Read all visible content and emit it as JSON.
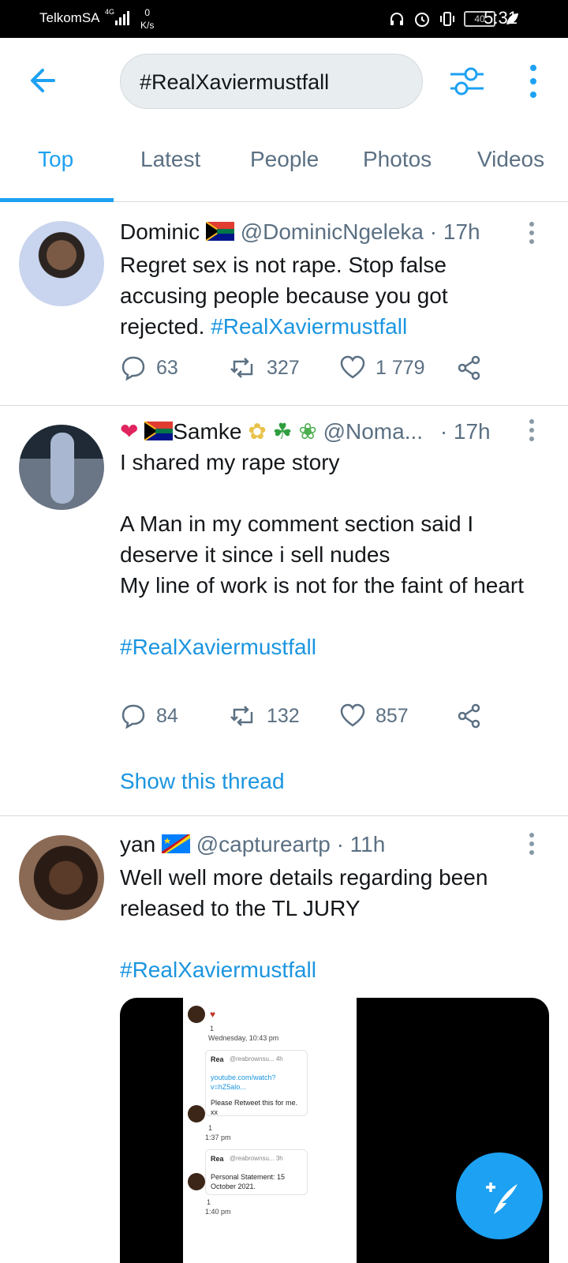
{
  "status_bar": {
    "carrier": "TelkomSA",
    "network": "4G",
    "speed_value": "0",
    "speed_unit": "K/s",
    "battery": "40",
    "time": "5:31"
  },
  "search": {
    "query": "#RealXaviermustfall"
  },
  "tabs": [
    {
      "label": "Top",
      "active": true
    },
    {
      "label": "Latest",
      "active": false
    },
    {
      "label": "People",
      "active": false
    },
    {
      "label": "Photos",
      "active": false
    },
    {
      "label": "Videos",
      "active": false
    }
  ],
  "tweets": [
    {
      "name": "Dominic",
      "handle": "@DominicNgeleka",
      "time": "· 17h",
      "text": "Regret sex is not rape. Stop false accusing people because you got rejected.",
      "hashtag": "#RealXaviermustfall",
      "replies": "63",
      "retweets": "327",
      "likes": "1 779"
    },
    {
      "name": "Samke",
      "handle": "@Noma...",
      "time": "· 17h",
      "line1": "I shared my rape story",
      "line2": "A Man in my comment section said I deserve it since i sell nudes",
      "line3": "My line of work is not for the faint of heart",
      "hashtag": "#RealXaviermustfall",
      "replies": "84",
      "retweets": "132",
      "likes": "857",
      "thread_link": "Show this thread"
    },
    {
      "name": "yan",
      "handle": "@captureartp",
      "time": "· 11h",
      "text": "Well well more details regarding been released to the TL JURY",
      "hashtag": "#RealXaviermustfall",
      "media": {
        "ts1": "Wednesday, 10:43 pm",
        "card1_name": "Rea",
        "card1_handle": "@reabrownsu... 4h",
        "card1_link": "youtube.com/watch?v=hZ5alo...",
        "card1_msg": "Please Retweet this for me. xx",
        "ts2": "1:37 pm",
        "card2_name": "Rea",
        "card2_handle": "@reabrownsu... 3h",
        "card2_msg": "Personal Statement: 15 October 2021.",
        "ts3": "1:40 pm",
        "count": "1"
      }
    }
  ],
  "colors": {
    "accent": "#1da1f2",
    "hashtag": "#1b95e0",
    "muted": "#5b7083"
  }
}
